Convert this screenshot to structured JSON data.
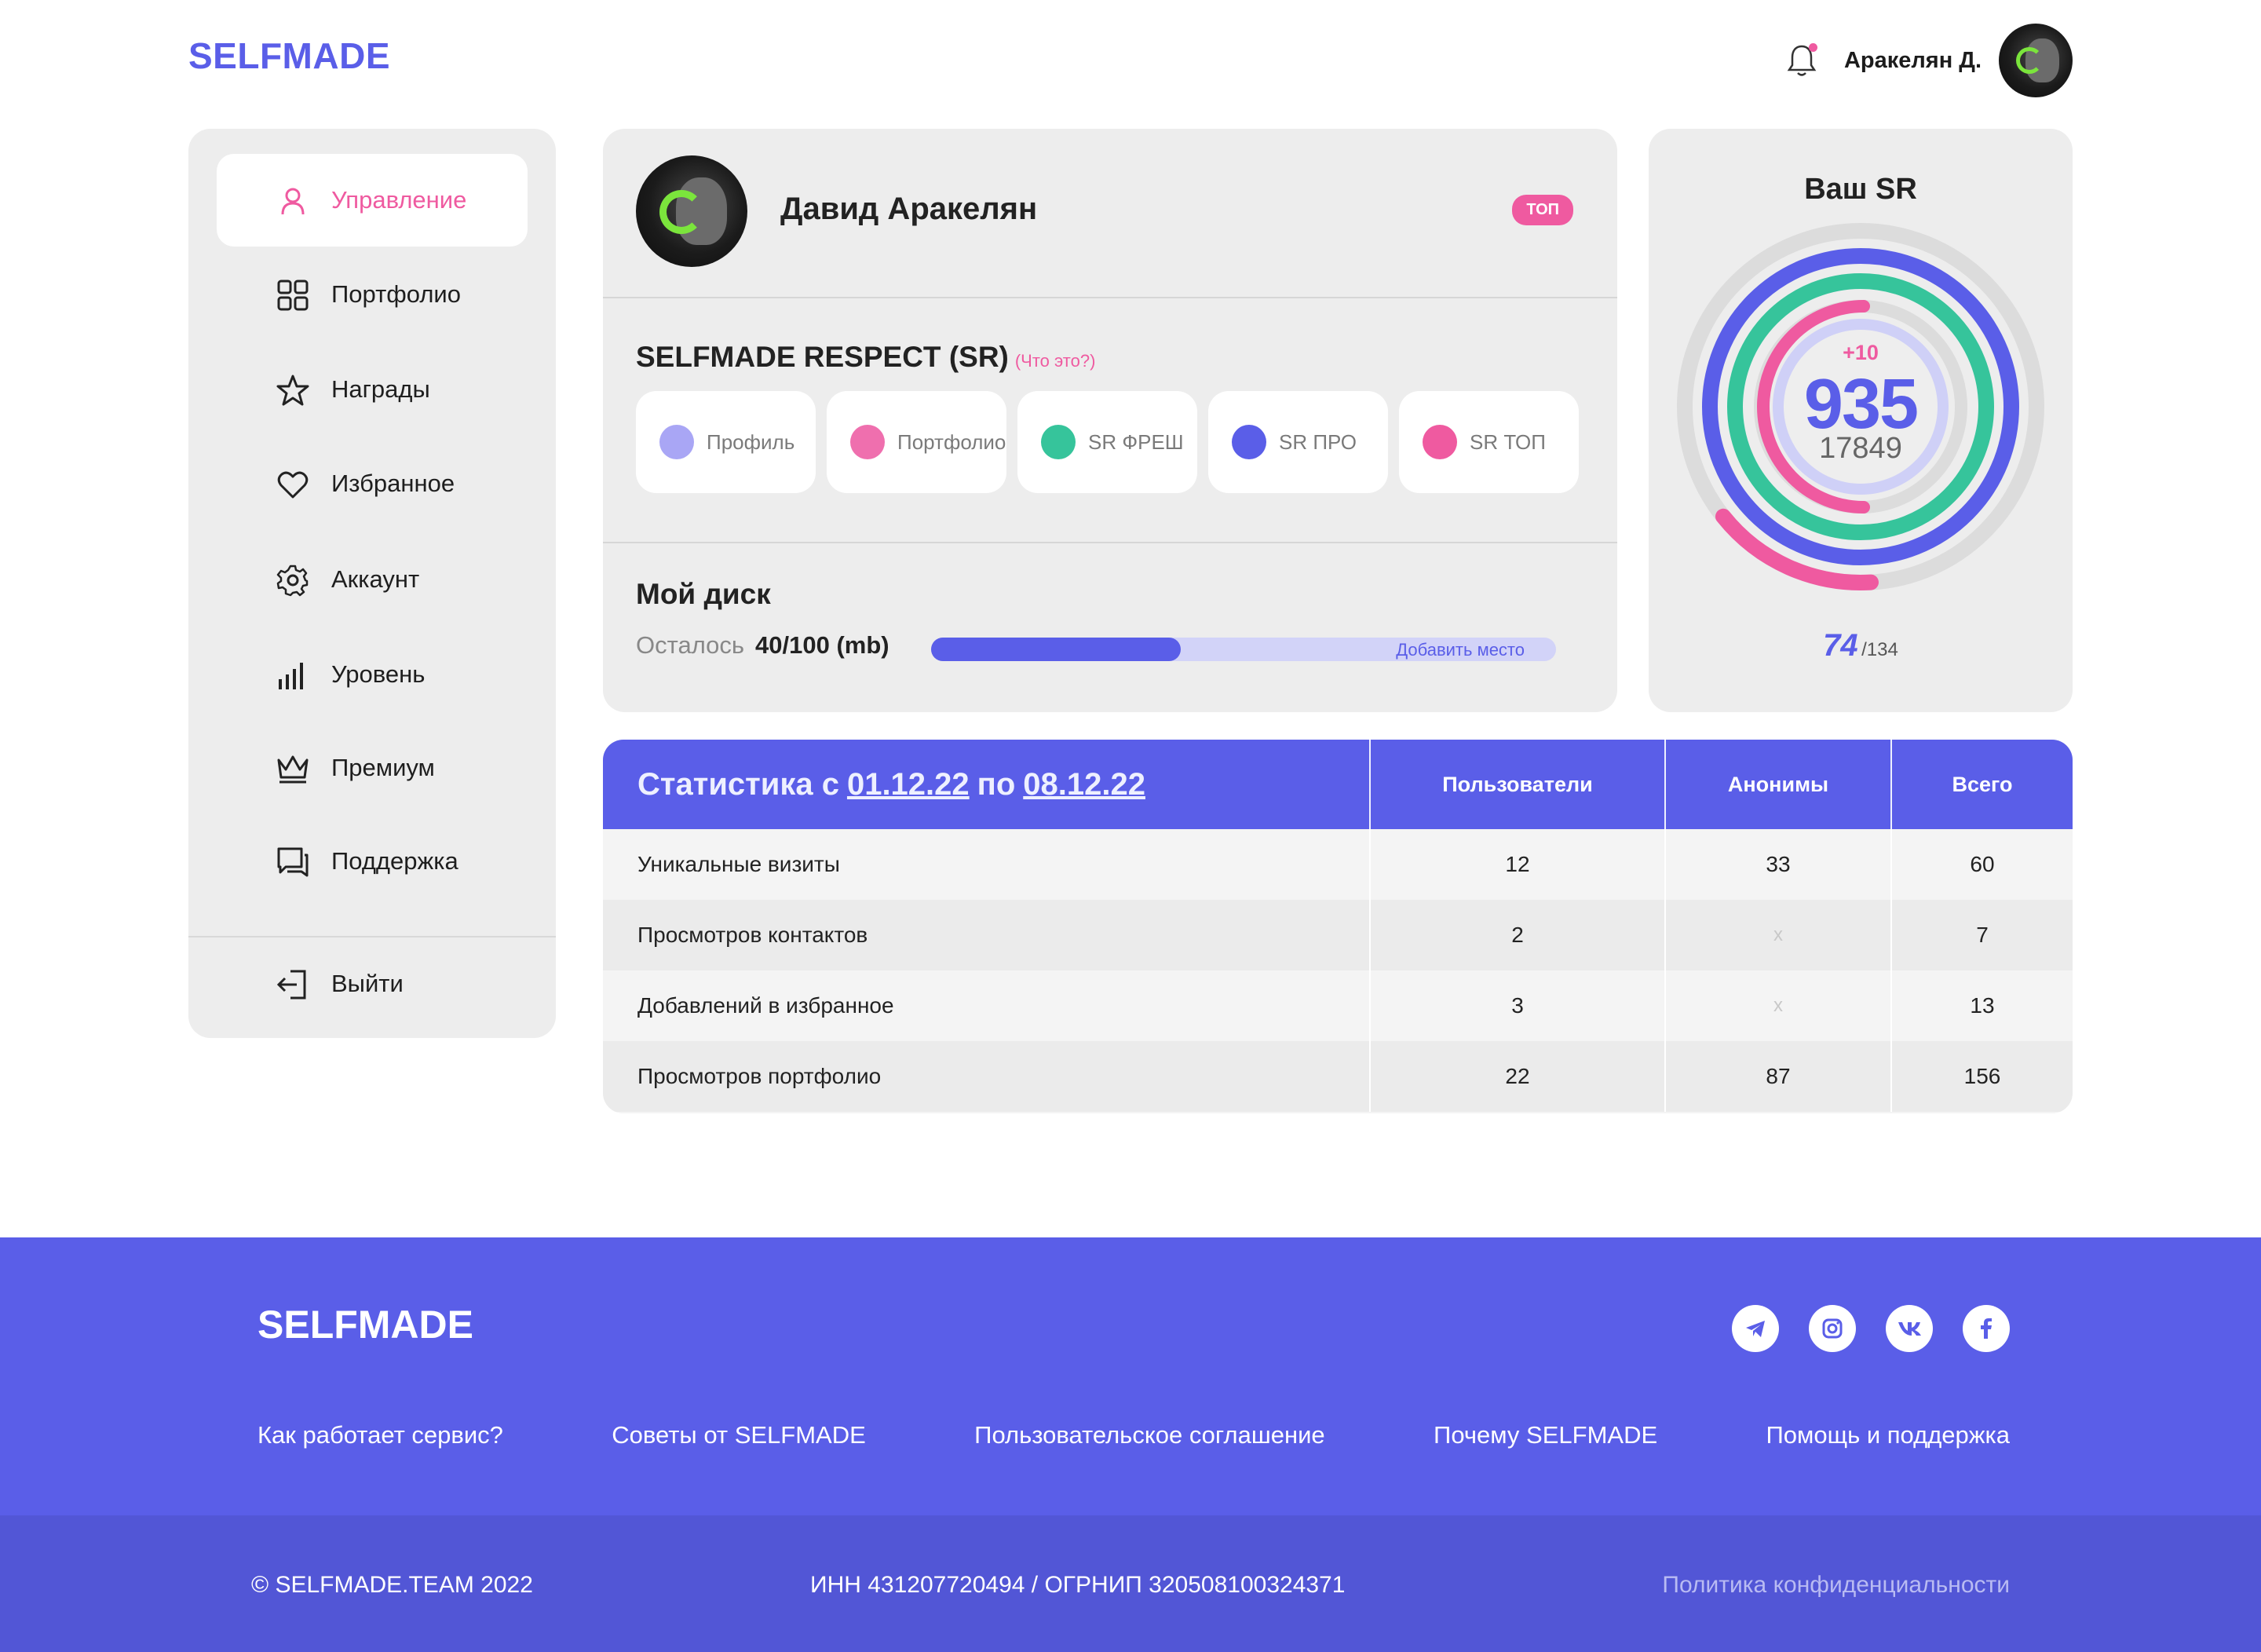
{
  "header": {
    "logo": "SELFMADE",
    "user_name": "Аракелян Д."
  },
  "sidebar": {
    "items": [
      {
        "label": "Управление",
        "icon": "user-icon",
        "active": true
      },
      {
        "label": "Портфолио",
        "icon": "grid-icon"
      },
      {
        "label": "Награды",
        "icon": "star-icon"
      },
      {
        "label": "Избранное",
        "icon": "heart-icon"
      },
      {
        "label": "Аккаунт",
        "icon": "gear-icon"
      },
      {
        "label": "Уровень",
        "icon": "level-bars-icon"
      },
      {
        "label": "Премиум",
        "icon": "crown-icon"
      },
      {
        "label": "Поддержка",
        "icon": "chat-icon"
      }
    ],
    "logout": "Выйти"
  },
  "profile": {
    "name": "Давид Аракелян",
    "badge": "ТОП",
    "sr_title": "SELFMADE RESPECT (SR)",
    "sr_what": "(Что это?)",
    "chips": [
      {
        "label": "Профиль",
        "color": "#a9a6f5"
      },
      {
        "label": "Портфолио",
        "color": "#ef6fae"
      },
      {
        "label": "SR ФРЕШ",
        "color": "#36c49b"
      },
      {
        "label": "SR ПРО",
        "color": "#5a5ee8"
      },
      {
        "label": "SR ТОП",
        "color": "#ef5aa0"
      }
    ],
    "disk_title": "Мой диск",
    "disk_label": "Осталось",
    "disk_value": "40/100 (mb)",
    "disk_fraction": 0.4,
    "disk_add": "Добавить место"
  },
  "sr": {
    "title": "Ваш SR",
    "delta": "+10",
    "value": "935",
    "total": "17849",
    "rank": "74",
    "rank_total": "/134"
  },
  "stats": {
    "title_prefix": "Статистика с",
    "date_from": "01.12.22",
    "title_mid": "по",
    "date_to": "08.12.22",
    "columns": [
      "Пользователи",
      "Анонимы",
      "Всего"
    ],
    "rows": [
      {
        "label": "Уникальные визиты",
        "users": "12",
        "anon": "33",
        "total": "60"
      },
      {
        "label": "Просмотров контактов",
        "users": "2",
        "anon": "x",
        "total": "7"
      },
      {
        "label": "Добавлений в избранное",
        "users": "3",
        "anon": "x",
        "total": "13"
      },
      {
        "label": "Просмотров портфолио",
        "users": "22",
        "anon": "87",
        "total": "156"
      }
    ]
  },
  "footer": {
    "logo": "SELFMADE",
    "links": [
      "Как работает сервис?",
      "Советы от SELFMADE",
      "Пользовательское соглашение",
      "Почему SELFMADE",
      "Помощь и поддержка"
    ],
    "socials": [
      "telegram-icon",
      "instagram-icon",
      "vk-icon",
      "facebook-icon"
    ],
    "copyright": "© SELFMADE.TEAM 2022",
    "inn": "ИНН 431207720494 / ОГРНИП 320508100324371",
    "policy": "Политика конфиденциальности"
  },
  "colors": {
    "accent": "#5a5ee8",
    "pink": "#ef5aa0",
    "green": "#36c49b",
    "lavender": "#a9a6f5"
  }
}
